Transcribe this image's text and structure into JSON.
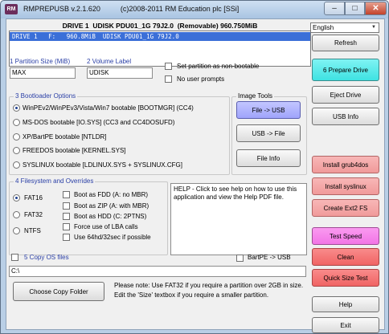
{
  "window": {
    "icon_text": "RM",
    "title": "RMPREPUSB v.2.1.620          (c)2008-2011 RM Education plc [SSi]",
    "min": "–",
    "max": "□",
    "close": "✕"
  },
  "drive": {
    "header": "DRIVE 1  UDISK PDU01_1G 79J2.0  (Removable) 960.750MiB",
    "selected_row": "DRIVE 1   F:   960.8MiB  UDISK PDU01_1G 79J2.0"
  },
  "language": {
    "selected": "English",
    "arrow": "▼"
  },
  "partition": {
    "size_label": "1 Partition Size (MiB)",
    "size_value": "MAX",
    "volume_label": "2 Volume Label",
    "volume_value": "UDISK",
    "non_bootable": "Set partition as non-bootable",
    "no_prompts": "No user prompts"
  },
  "bootloader": {
    "title": "3 Bootloader Options",
    "options": [
      "WinPEv2/WinPEv3/Vista/Win7 bootable [BOOTMGR] (CC4)",
      "MS-DOS bootable [IO.SYS]     (CC3 and CC4DOSUFD)",
      "XP/BartPE bootable [NTLDR]",
      "FREEDOS bootable [KERNEL.SYS]",
      "SYSLINUX bootable [LDLINUX.SYS + SYSLINUX.CFG]"
    ]
  },
  "image_tools": {
    "title": "Image Tools",
    "file_to_usb": "File -> USB",
    "usb_to_file": "USB -> File",
    "file_info": "File Info"
  },
  "filesystem": {
    "title": "4 Filesystem and Overrides",
    "fs": [
      "FAT16",
      "FAT32",
      "NTFS"
    ],
    "overrides": [
      "Boot as FDD (A: no MBR)",
      "Boot as ZIP (A: with MBR)",
      "Boot as HDD (C: 2PTNS)",
      "Force use of LBA calls",
      "Use 64hd/32sec if possible"
    ]
  },
  "help_text": "HELP - Click to see help on how to use this application and view the Help PDF file.",
  "copy_os": {
    "label": "5 Copy OS files",
    "bartpe": "BartPE -> USB",
    "path": "C:\\",
    "choose_button": "Choose Copy Folder",
    "note": "Please note: Use FAT32 if you require a partition over 2GB in size. Edit the 'Size' textbox if you require a smaller partition."
  },
  "right_buttons": {
    "refresh": "Refresh",
    "prepare": "6 Prepare Drive",
    "eject": "Eject Drive",
    "usb_info": "USB Info",
    "grub4dos": "Install grub4dos",
    "syslinux": "Install syslinux",
    "ext2": "Create Ext2 FS",
    "test_speed": "Test Speed",
    "clean": "Clean",
    "quick_size": "Quick Size Test",
    "help": "Help",
    "exit": "Exit"
  }
}
